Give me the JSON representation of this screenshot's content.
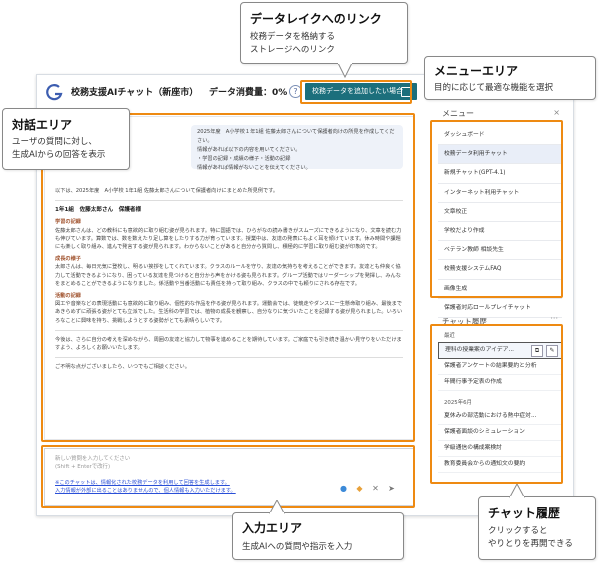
{
  "header": {
    "title": "校務支援AIチャット（新座市）",
    "usage": "データ消費量：0%",
    "help": "?",
    "add_button": "校務データを追加したい場合"
  },
  "chat": {
    "user_message": [
      "2025年度　A小学校１年1組 佐藤太郎さんについて保護者向けの所見を作成してください。",
      "情報があれば以下の内容を用いてください。",
      "・学習の記録・成績の様子・活動の記録",
      "情報があれば情報がないことを伝えてください。"
    ],
    "reply_intro": "以下は、2025年度　A小学校 1年1組 佐藤太郎さんについて保護者向けにまとめた所見例です。",
    "reply_heading": "1年1組　佐藤太郎さん　保護者様",
    "sections": [
      {
        "heading": "学習の記録",
        "text": "佐藤太郎さんは、どの教科にも意欲的に取り組む姿が見られます。特に国語では、ひらがなの読み書きがスムーズにできるようになり、文章を読む力も伸びています。算数では、数を数えたり足し算をしたりする力が育っています。授業中は、友達の発表にもよく耳を傾けています。休み時間や課題にも楽しく取り組み、進んで発言する姿が見られます。わからないことがあると自分から質問し、積極的に学習に取り組む姿が印象的です。"
      },
      {
        "heading": "成長の様子",
        "text": "太郎さんは、毎日元気に登校し、明るい挨拶をしてくれています。クラスのルールを守り、友達の気持ちを考えることができます。友達とも仲良く協力して活動できるようになり、困っている友達を見つけると自分から声をかける姿も見られます。グループ活動ではリーダーシップを発揮し、みんなをまとめることができるようになりました。係活動や当番活動にも責任を持って取り組み、クラスの中でも頼りにされる存在です。"
      },
      {
        "heading": "活動の記録",
        "text": "図工や音楽などの表現活動にも意欲的に取り組み、個性的な作品を作る姿が見られます。運動会では、徒競走やダンスに一生懸命取り組み、最後まであきらめずに頑張る姿がとても立派でした。生活科の学習では、植物の成長を観察し、自分なりに気づいたことを記録する姿が見られました。いろいろなことに興味を持ち、挑戦しようとする姿勢がとても素晴らしいです。"
      }
    ],
    "closing": "今後は、さらに自分の考えを深めながら、周囲の友達と協力して物事を進めることを期待しています。ご家庭でも引き続き温かい見守りをいただけますよう、よろしくお願いいたします。",
    "follow": "ご不明な点がございましたら、いつでもご相談ください。"
  },
  "input": {
    "placeholder": "新しい質問を入力してください",
    "hint": "(Shift + Enterで改行)",
    "notice_1": "※このチャットは、情報化された校務データを利用して回答を生成します。",
    "notice_2": "入力情報が外部に出ることはありませんので、個人情報も入力いただけます。"
  },
  "menu": {
    "title": "メニュー",
    "close": "×",
    "items": [
      "ダッシュボード",
      "校務データ利用チャット",
      "新規チャット(GPT-4.1)",
      "インターネット利用チャット",
      "文章校正",
      "学校だより作成",
      "ベテラン教師 相談先生",
      "校務支援システムFAQ",
      "画像生成",
      "保護者対応ロールプレイチャット"
    ],
    "selected_index": 1
  },
  "history": {
    "title": "チャット履歴",
    "dots": "···",
    "groups": [
      {
        "label": "最近",
        "items": [
          "理科の授業案のアイデア...",
          "保護者アンケートの結果要約と分析",
          "年間行事予定表の作成"
        ]
      },
      {
        "label": "2025年6月",
        "items": [
          "夏休みの部活動における熱中症対...",
          "保護者面談のシミュレーション",
          "学級通信の構成案検討",
          "教育委員会からの通知文の要約"
        ]
      }
    ]
  },
  "callouts": {
    "datalake": {
      "title": "データレイクへのリンク",
      "desc": [
        "校務データを格納する",
        "ストレージへのリンク"
      ]
    },
    "menu_area": {
      "title": "メニューエリア",
      "desc": [
        "目的に応じて最適な機能を選択"
      ]
    },
    "dialog_area": {
      "title": "対話エリア",
      "desc": [
        "ユーザの質問に対し、",
        "生成AIからの回答を表示"
      ]
    },
    "input_area": {
      "title": "入力エリア",
      "desc": [
        "生成AIへの質問や指示を入力"
      ]
    },
    "history_area": {
      "title": "チャット履歴",
      "desc": [
        "クリックすると",
        "やりとりを再開できる"
      ]
    }
  },
  "colors": {
    "accent_outline": "#ee8a12",
    "button": "#1c6f7c",
    "notice": "#2a4fd7"
  }
}
